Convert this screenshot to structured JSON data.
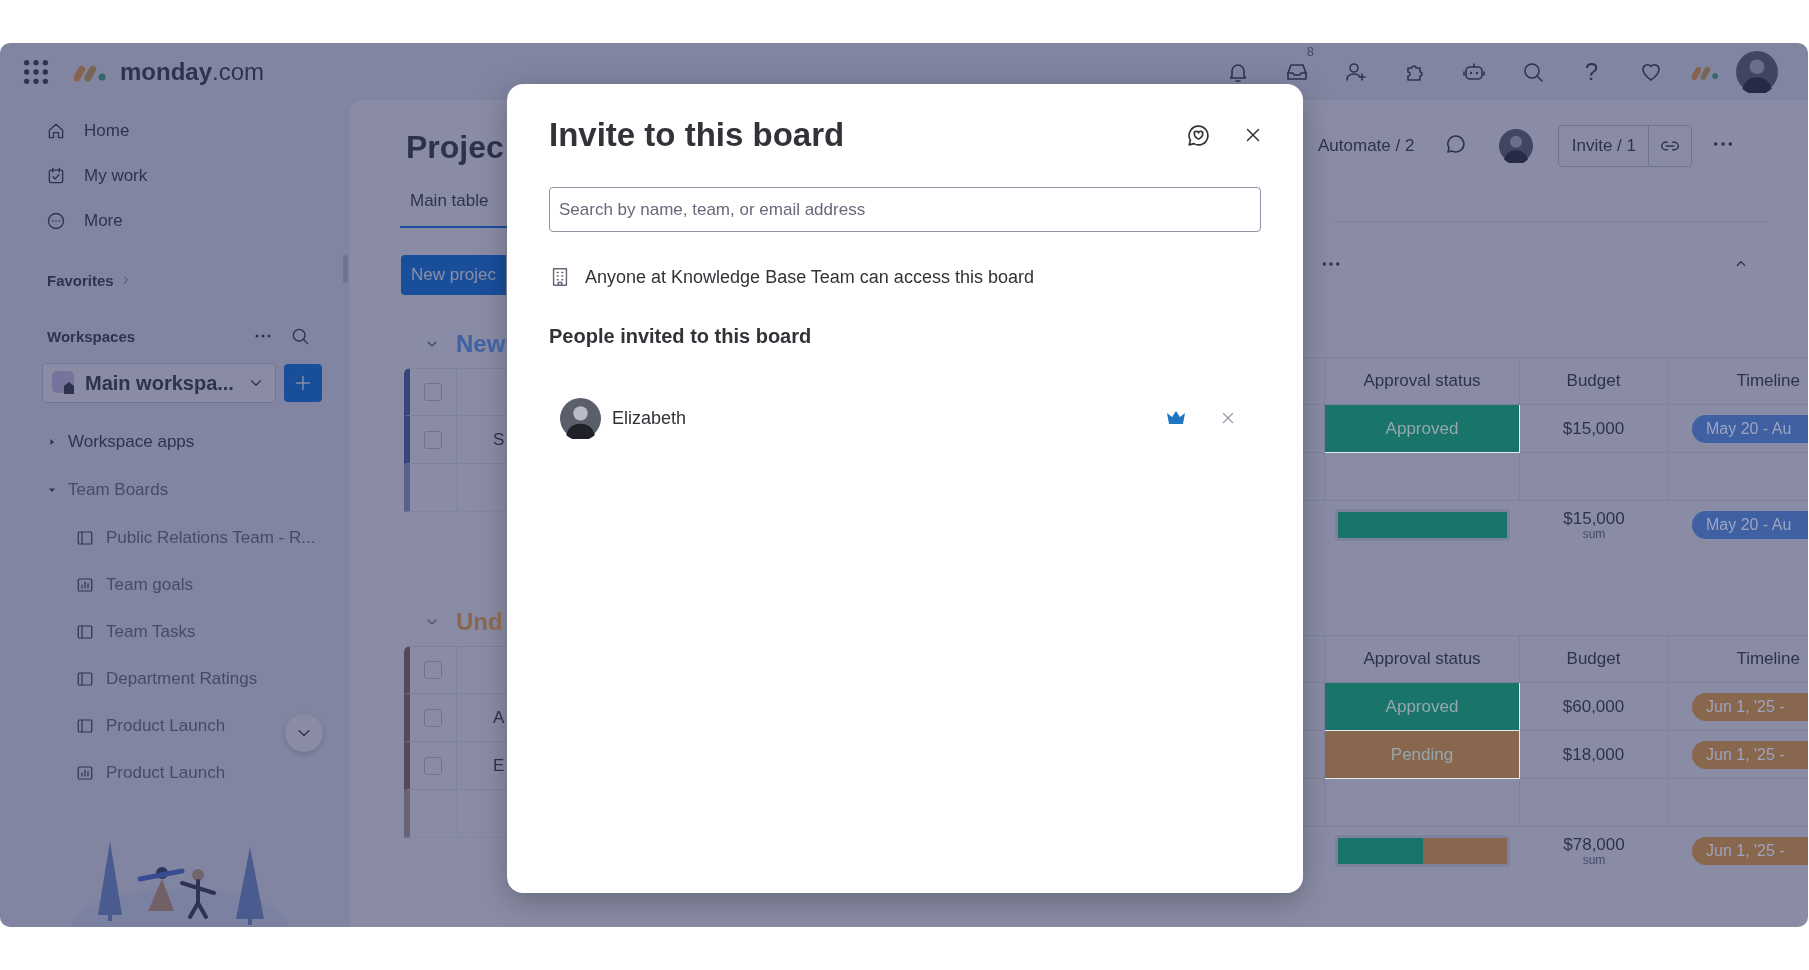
{
  "top_bar": {
    "logo": "**monday**.com",
    "inbox_count": "8",
    "help": "?"
  },
  "sidebar": {
    "nav": [
      {
        "label": "Home"
      },
      {
        "label": "My work"
      },
      {
        "label": "More"
      }
    ],
    "favorites": "Favorites",
    "workspaces": "Workspaces",
    "workspace": "Main workspa...",
    "tree": [
      {
        "label": "Workspace apps",
        "expanded": false
      },
      {
        "label": "Team Boards",
        "expanded": true,
        "children": [
          {
            "label": "Public Relations Team - R...",
            "kind": "board"
          },
          {
            "label": "Team goals",
            "kind": "dashboard"
          },
          {
            "label": "Team Tasks",
            "kind": "board"
          },
          {
            "label": "Department Ratings",
            "kind": "board"
          },
          {
            "label": "Product Launch",
            "kind": "board"
          },
          {
            "label": "Product Launch",
            "kind": "dashboard"
          }
        ]
      }
    ]
  },
  "board": {
    "title": "Projec",
    "tabs": [
      {
        "label": "Main table",
        "selected": true
      }
    ],
    "new_item_button": "New projec",
    "toolbar": {
      "automate": "Automate / 2",
      "invite": "Invite / 1"
    },
    "groups": [
      {
        "title": "New",
        "color": "#3f60a2",
        "all_checked": false,
        "columns": [
          "Approval status",
          "Budget",
          "Timeline"
        ],
        "items": [
          {
            "name": "S",
            "checked": false,
            "status": {
              "label": "Approved",
              "color": "#19746a"
            },
            "budget": "$15,000",
            "timeline": {
              "label": "May 20 - Au",
              "color": "#3f60a2"
            }
          }
        ],
        "summary": {
          "status_shares": [
            {
              "color": "#19746a",
              "level": 1
            }
          ],
          "budget": "$15,000",
          "budget_note": "sum",
          "timeline": {
            "label": "May 20 - Au",
            "color": "#3f60a2"
          }
        }
      },
      {
        "title": "Und",
        "color": "#88674e",
        "all_checked": false,
        "columns": [
          "Approval status",
          "Budget",
          "Timeline"
        ],
        "items": [
          {
            "name": "A",
            "checked": false,
            "status": {
              "label": "Approved",
              "color": "#19746a"
            },
            "budget": "$60,000",
            "timeline": {
              "label": "Jun 1, '25 -",
              "color": "#88674e"
            }
          },
          {
            "name": "E",
            "checked": false,
            "status": {
              "label": "Pending",
              "color": "#88674e"
            },
            "budget": "$18,000",
            "timeline": {
              "label": "Jun 1, '25 -",
              "color": "#88674e"
            }
          }
        ],
        "summary": {
          "status_shares": [
            {
              "color": "#19746a",
              "level": 0.5
            },
            {
              "color": "#88674e",
              "level": 0.5
            }
          ],
          "budget": "$78,000",
          "budget_note": "sum",
          "timeline": {
            "label": "Jun 1, '25 -",
            "color": "#88674e"
          }
        }
      }
    ]
  },
  "invite_dialog": {
    "title": "Invite to this board",
    "search": {
      "placeholder": "Search by name, team, or email address"
    },
    "access_note": "Anyone at Knowledge Base Team can access this board",
    "people_heading": "People invited to this board",
    "people": [
      {
        "name": "Elizabeth",
        "owner": true
      }
    ]
  }
}
